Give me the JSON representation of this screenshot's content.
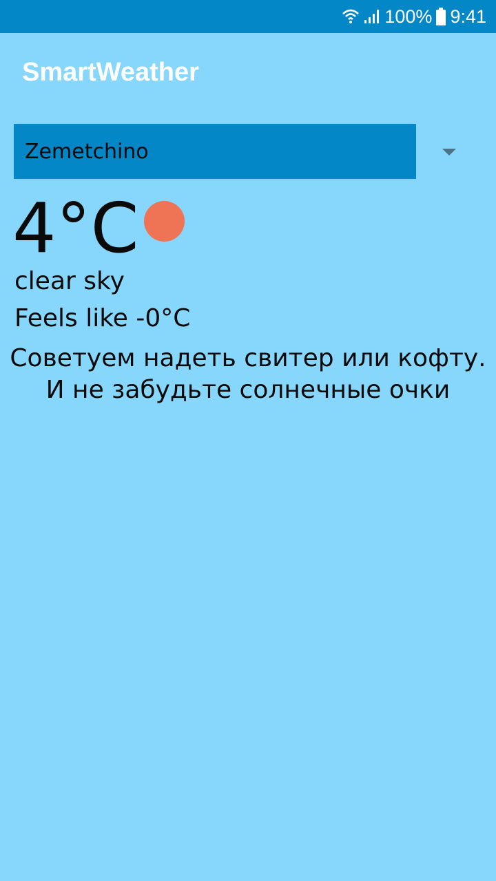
{
  "status_bar": {
    "battery_percent": "100%",
    "time": "9:41",
    "icons": [
      "wifi-icon",
      "signal-icon",
      "battery-icon"
    ],
    "background_color": "#0387C6"
  },
  "app": {
    "title": "SmartWeather",
    "background_color": "#87D7FD"
  },
  "city_select": {
    "selected_value": "Zemetchino",
    "arrow_icon": "dropdown-arrow-icon"
  },
  "weather": {
    "temperature": "4°C",
    "condition_icon": "sun-icon",
    "condition_icon_color": "#EF7355",
    "description": "clear sky",
    "feels_like": "Feels like -0°C"
  },
  "advice": {
    "line1": "Советуем надеть свитер или кофту.",
    "line2": "И не забудьте солнечные очки"
  }
}
